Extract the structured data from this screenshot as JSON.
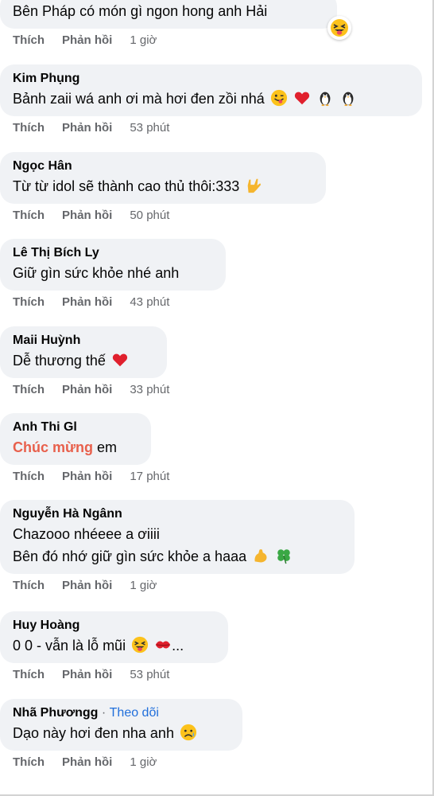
{
  "action_labels": {
    "like": "Thích",
    "reply": "Phản hồi"
  },
  "comments": [
    {
      "author": "",
      "lines": [
        "Bên Pháp có món gì ngon hong anh Hải"
      ],
      "time": "1 giờ"
    },
    {
      "author": "Kim Phụng",
      "lines": [
        "Bảnh zaii wá anh ơi mà hơi đen zồi nhá"
      ],
      "time": "53 phút"
    },
    {
      "author": "Ngọc Hân",
      "lines": [
        "Từ từ idol sẽ thành cao thủ thôi:333"
      ],
      "time": "50 phút"
    },
    {
      "author": "Lê Thị Bích Ly",
      "lines": [
        "Giữ gìn sức khỏe nhé anh"
      ],
      "time": "43 phút"
    },
    {
      "author": "Maii Huỳnh",
      "lines": [
        "Dễ thương thế"
      ],
      "time": "33 phút"
    },
    {
      "author": "Anh Thi Gl",
      "lines": [
        "Chúc mừng",
        "em"
      ],
      "time": "17 phút"
    },
    {
      "author": "Nguyễn Hà Ngânn",
      "lines": [
        "Chazooo nhéeee a ơiiii",
        "Bên đó nhớ giữ gìn sức khỏe a haaa"
      ],
      "time": "1 giờ"
    },
    {
      "author": "Huy Hoàng",
      "lines": [
        "0 0 - vẫn là lỗ mũi",
        "..."
      ],
      "time": "53 phút"
    },
    {
      "author": "Nhã Phươngg",
      "follow": {
        "dot": "·",
        "label": "Theo dõi"
      },
      "lines": [
        "Dạo này hơi đen nha anh"
      ],
      "time": "1 giờ"
    }
  ],
  "icons": [
    "squinting-tongue-emoji",
    "winking-tongue-emoji",
    "red-heart-emoji",
    "penguin-emoji",
    "love-you-gesture-emoji",
    "flexed-biceps-emoji",
    "four-leaf-clover-emoji",
    "kiss-mark-emoji",
    "sad-relieved-emoji"
  ]
}
